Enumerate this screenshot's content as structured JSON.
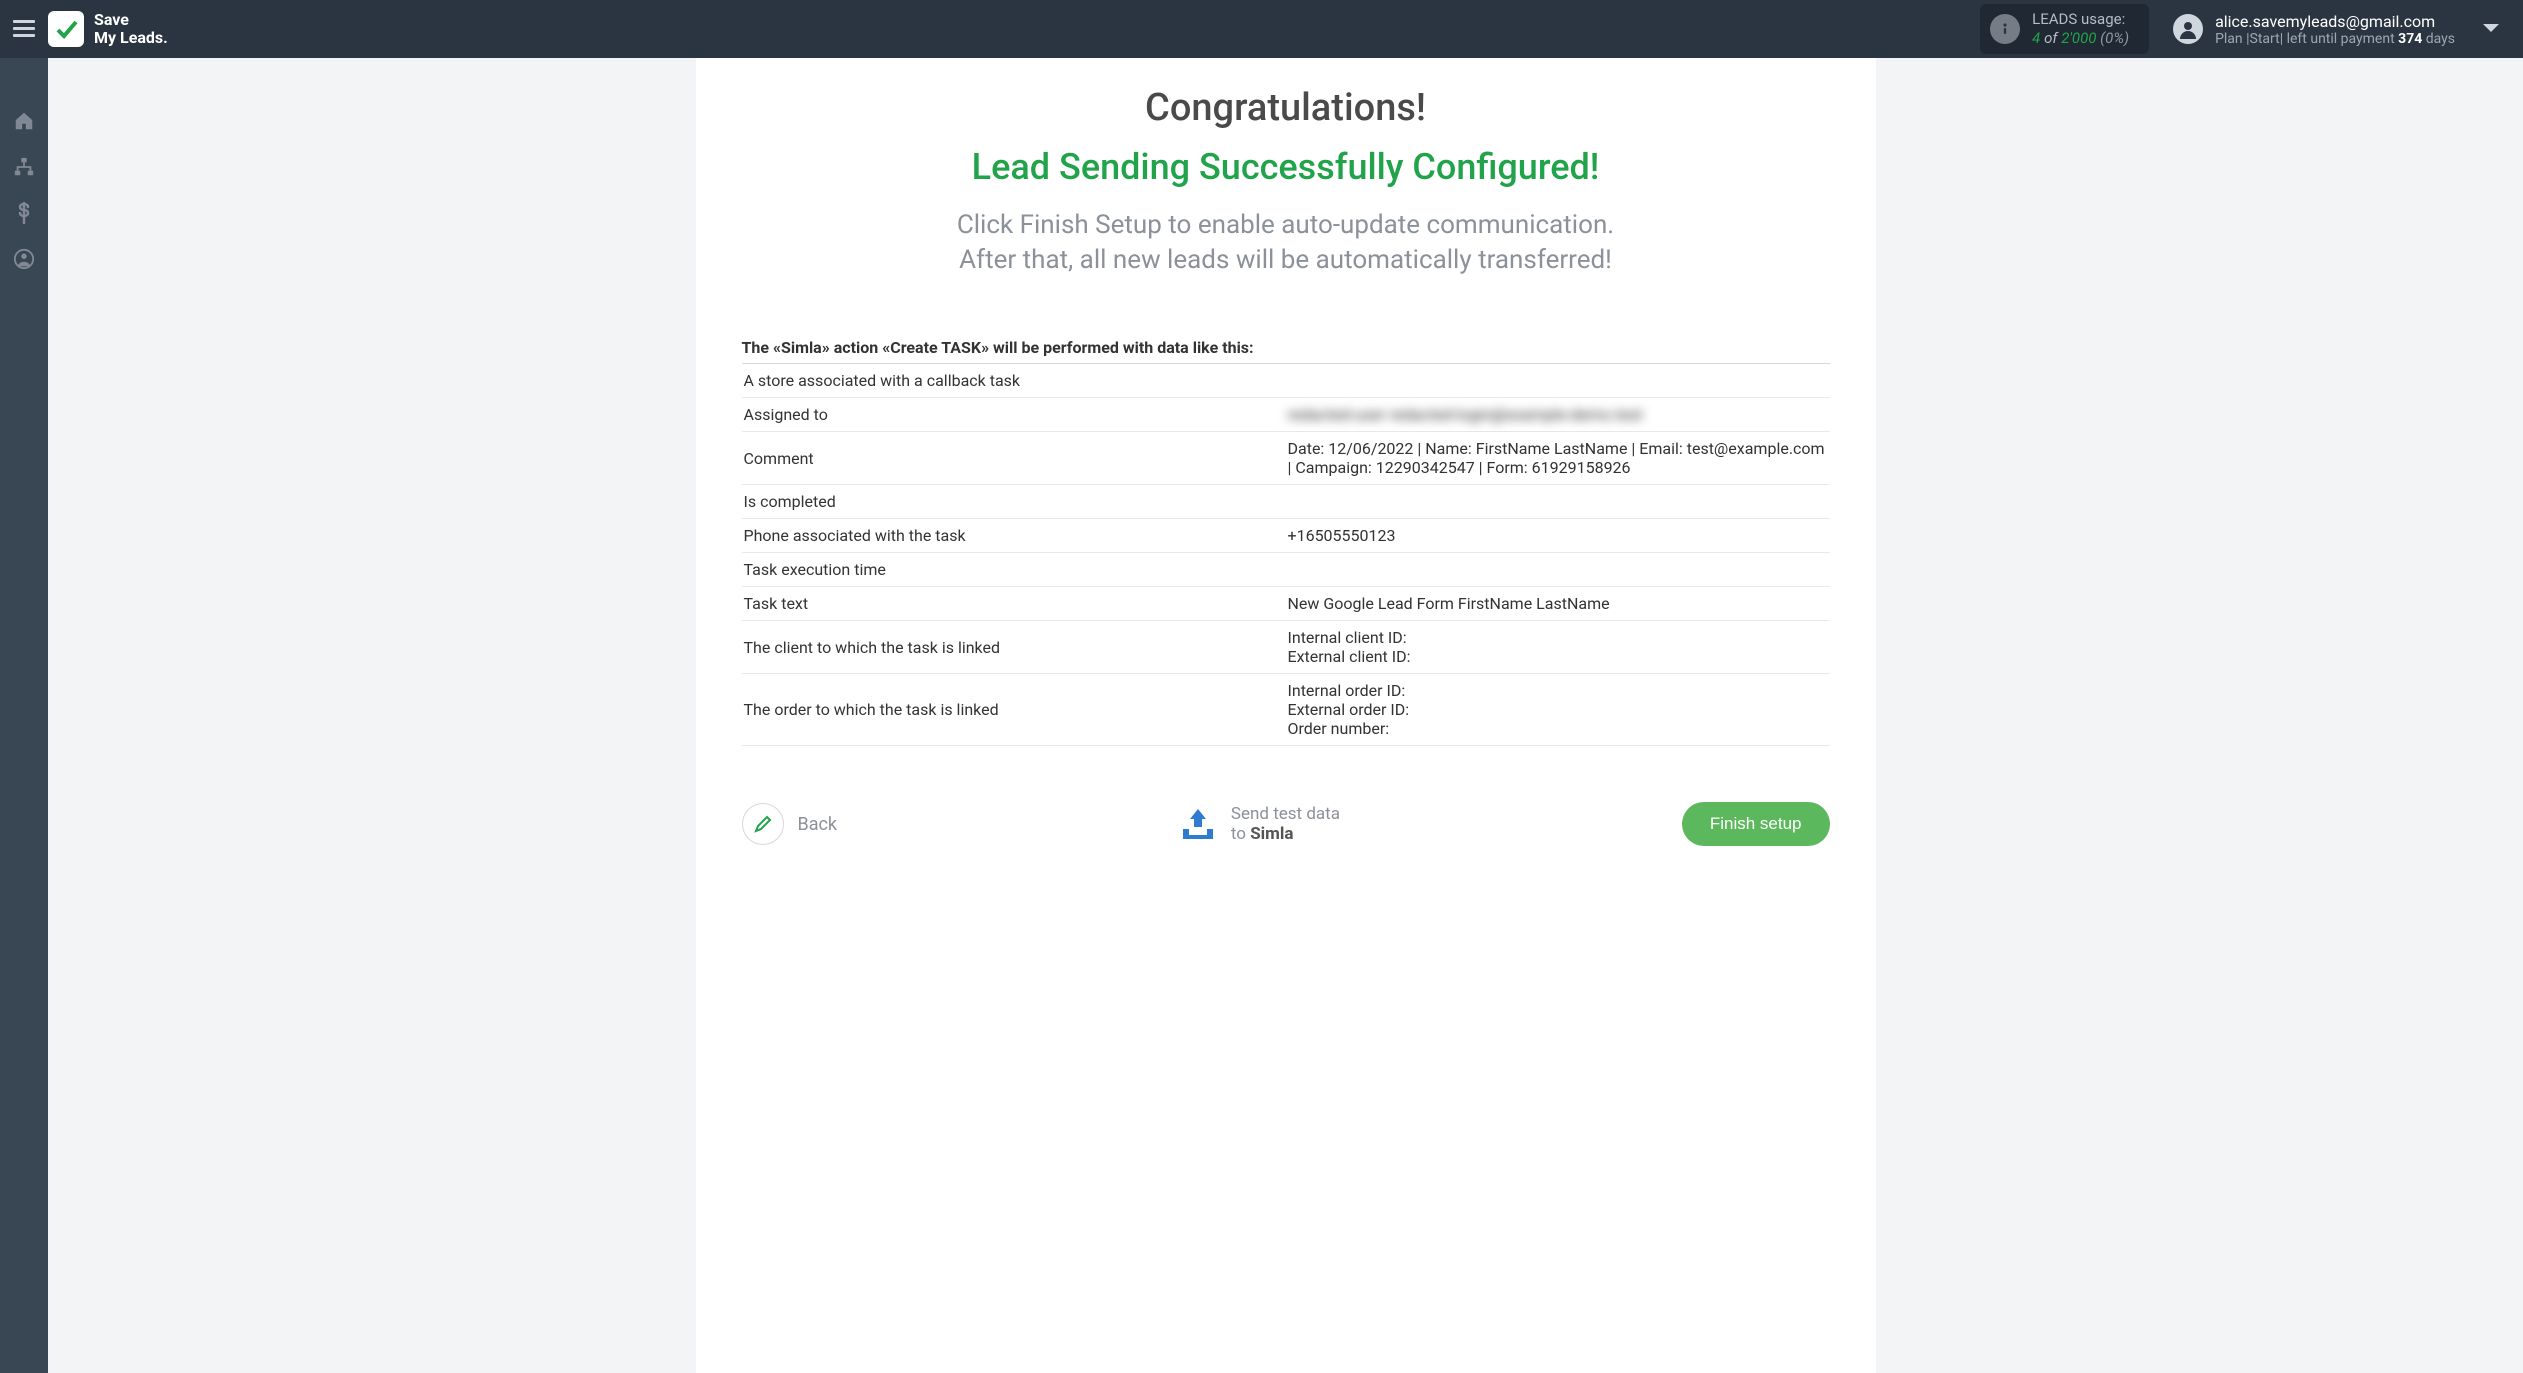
{
  "header": {
    "logo_line1": "Save",
    "logo_line2": "My Leads.",
    "usage": {
      "label": "LEADS usage:",
      "used": "4",
      "of": "of",
      "total": "2'000",
      "pct": "(0%)"
    },
    "account": {
      "email": "alice.savemyleads@gmail.com",
      "plan_prefix": "Plan |Start| left until payment ",
      "plan_days": "374",
      "plan_suffix": " days"
    }
  },
  "panel": {
    "congrats": "Congratulations!",
    "success": "Lead Sending Successfully Configured!",
    "desc_l1": "Click Finish Setup to enable auto-update communication.",
    "desc_l2": "After that, all new leads will be automatically transferred!",
    "table_caption": "The «Simla» action «Create TASK» will be performed with data like this:",
    "rows": [
      {
        "label": "A store associated with a callback task",
        "value": ""
      },
      {
        "label": "Assigned to",
        "value": "redacted-user redacted-login@example-demo.test",
        "blur": true
      },
      {
        "label": "Comment",
        "value": "Date: 12/06/2022 | Name: FirstName LastName | Email: test@example.com | Campaign: 12290342547 | Form: 61929158926"
      },
      {
        "label": "Is completed",
        "value": ""
      },
      {
        "label": "Phone associated with the task",
        "value": "+16505550123"
      },
      {
        "label": "Task execution time",
        "value": ""
      },
      {
        "label": "Task text",
        "value": "New Google Lead Form FirstName LastName"
      },
      {
        "label": "The client to which the task is linked",
        "value": "Internal client ID:\nExternal client ID:"
      },
      {
        "label": "The order to which the task is linked",
        "value": "Internal order ID:\nExternal order ID:\nOrder number:"
      }
    ]
  },
  "footer": {
    "back": "Back",
    "send_l1": "Send test data",
    "send_l2_prefix": "to ",
    "send_l2_bold": "Simla",
    "finish": "Finish setup"
  }
}
